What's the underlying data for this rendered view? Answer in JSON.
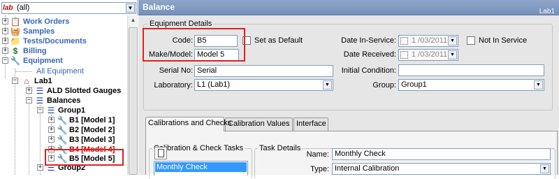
{
  "lab_selector": {
    "icon_text": "lab",
    "value": "(all)"
  },
  "tree": {
    "work_orders": "Work Orders",
    "samples": "Samples",
    "tests_documents": "Tests/Documents",
    "billing": "Billing",
    "equipment": "Equipment",
    "all_equipment": "All Equipment",
    "lab1": "Lab1",
    "ald_slotted_gauges": "ALD Slotted Gauges",
    "balances": "Balances",
    "group1": "Group1",
    "b1": "B1 [Model 1]",
    "b2": "B2 [Model 2]",
    "b3": "B3 [Model 3]",
    "b4": "B4 [Model 4]",
    "b5": "B5 [Model 5]",
    "group2": "Group2"
  },
  "header": {
    "title": "Balance",
    "subtitle": "Lab1"
  },
  "equipment_details": {
    "legend": "Equipment Details",
    "code_label": "Code:",
    "code_value": "B5",
    "set_default_label": "Set as Default",
    "make_model_label": "Make/Model:",
    "make_model_value": "Model 5",
    "serial_label": "Serial No:",
    "serial_value": "Serial",
    "laboratory_label": "Laboratory:",
    "laboratory_value": "L1 (Lab1)",
    "date_in_service_label": "Date In-Service:",
    "date_in_service_value": "1 /03/2011",
    "not_in_service_label": "Not In Service",
    "date_received_label": "Date Received:",
    "date_received_value": "1 /03/2011",
    "initial_condition_label": "Initial Condition:",
    "initial_condition_value": "",
    "group_label": "Group:",
    "group_value": "Group1"
  },
  "tabs": [
    "Calibrations and Checks",
    "Calibration Values",
    "Interface"
  ],
  "calibration_tasks": {
    "legend": "Calibration & Check Tasks",
    "items": [
      "Monthly Check"
    ]
  },
  "task_details": {
    "legend": "Task Details",
    "name_label": "Name:",
    "name_value": "Monthly Check",
    "type_label": "Type:",
    "type_value": "Internal Calibration"
  },
  "colors": {
    "header_bg": "#7f98c2",
    "tree_link": "#3866b6",
    "highlight_red": "#e02020",
    "selection": "#3399ff"
  }
}
